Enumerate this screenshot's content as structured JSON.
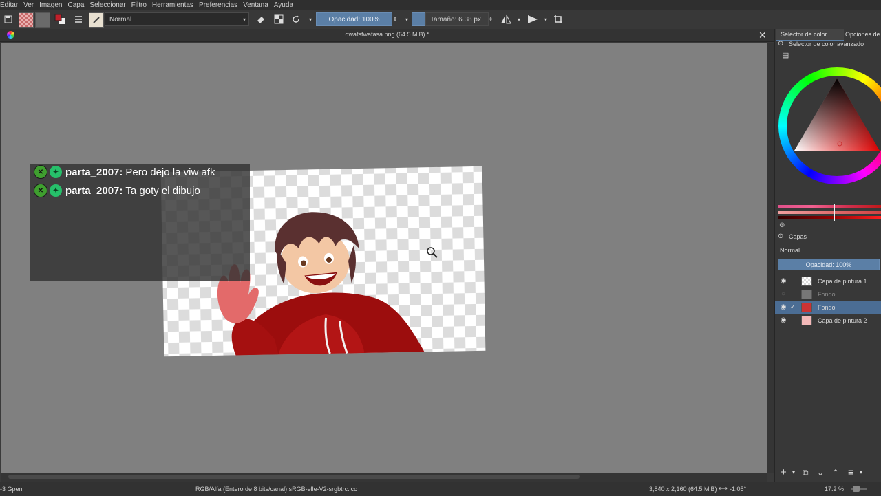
{
  "menu": [
    "Editar",
    "Ver",
    "Imagen",
    "Capa",
    "Seleccionar",
    "Filtro",
    "Herramientas",
    "Preferencias",
    "Ventana",
    "Ayuda"
  ],
  "toolbar": {
    "blend_mode": "Normal",
    "opacity_label": "Opacidad: 100%",
    "size_label": "Tamaño: 6.38 px"
  },
  "document": {
    "title": "dwafsfwafasa.png (64.5 MiB) *"
  },
  "chat": [
    {
      "user": "parta_2007:",
      "message": "Pero dejo la viw afk"
    },
    {
      "user": "parta_2007:",
      "message": "Ta goty el dibujo"
    }
  ],
  "dock": {
    "tab1": "Selector de color ...",
    "tab2": "Opciones de la",
    "color_panel_title": "Selector de color avanzado",
    "layers_title": "Capas",
    "layer_blend": "Normal",
    "layer_opacity": "Opacidad:  100%",
    "layers": [
      {
        "name": "Capa de pintura 1",
        "visible": true,
        "selected": false
      },
      {
        "name": "Fondo",
        "visible": false,
        "selected": false
      },
      {
        "name": "Fondo",
        "visible": true,
        "selected": true
      },
      {
        "name": "Capa de pintura 2",
        "visible": true,
        "selected": false
      }
    ]
  },
  "status": {
    "left": "-3 Gpen",
    "colorspace": "RGB/Alfa (Entero de 8 bits/canal)  sRGB-elle-V2-srgbtrc.icc",
    "dimensions": "3,840 x 2,160 (64.5 MiB)",
    "rotation": "-1.05°",
    "zoom": "17.2 %"
  },
  "colors": {
    "accent": "#5b7fa6",
    "selected_layer": "#4b6d94",
    "canvas_bg": "#808080"
  }
}
